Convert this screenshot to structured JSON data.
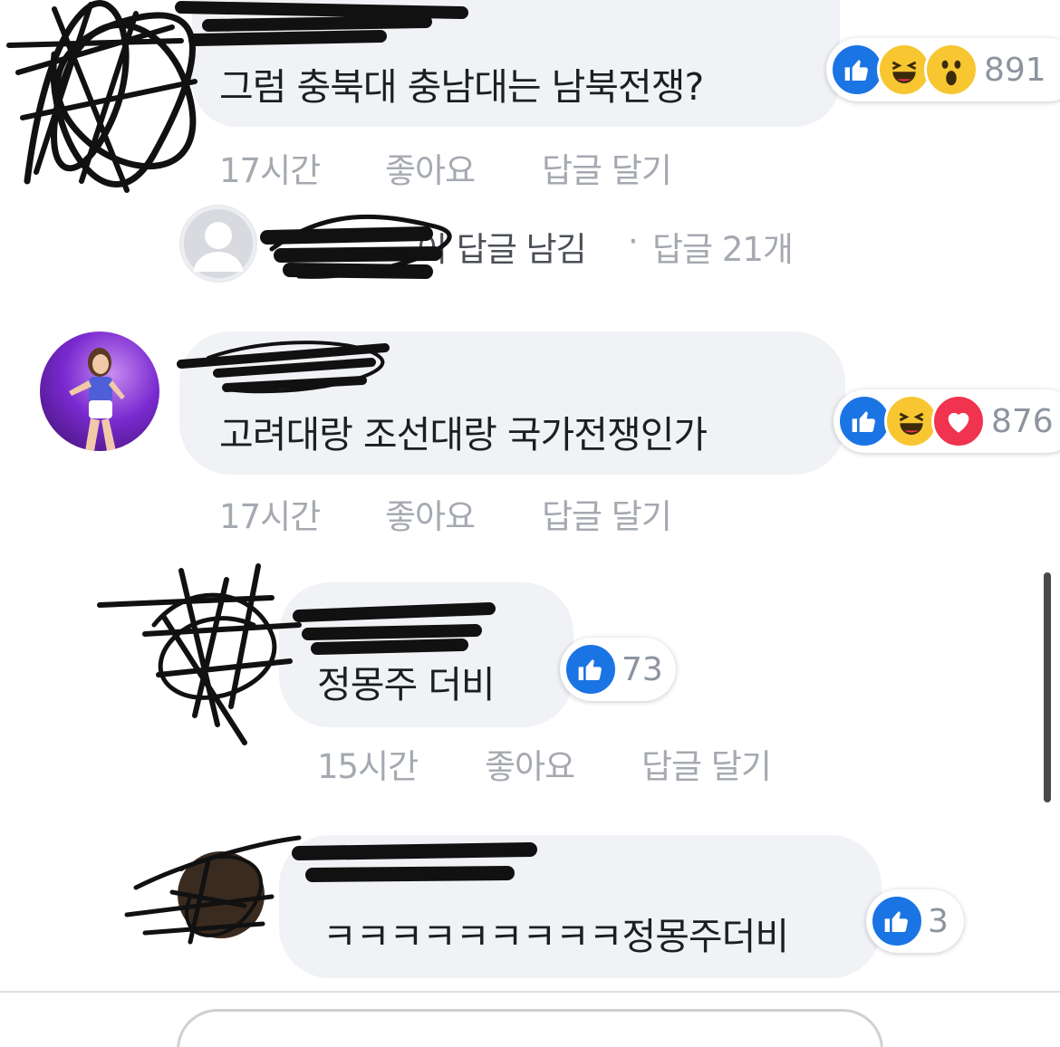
{
  "comments": [
    {
      "text": "그럼 충북대 충남대는 남북전쟁?",
      "reactions": [
        "like-icon",
        "haha-icon",
        "wow-icon"
      ],
      "reaction_count": "891",
      "time": "17시간",
      "like_label": "좋아요",
      "reply_label": "답글 달기",
      "replies_summary": {
        "author_suffix": "이 답글 남김",
        "dot": "·",
        "count_label": "답글 21개"
      }
    },
    {
      "text": "고려대랑 조선대랑 국가전쟁인가",
      "reactions": [
        "like-icon",
        "haha-icon",
        "love-icon"
      ],
      "reaction_count": "876",
      "time": "17시간",
      "like_label": "좋아요",
      "reply_label": "답글 달기"
    },
    {
      "text": "정몽주 더비",
      "reactions": [
        "like-icon"
      ],
      "reaction_count": "73",
      "time": "15시간",
      "like_label": "좋아요",
      "reply_label": "답글 달기"
    },
    {
      "text": "ㅋㅋㅋㅋㅋㅋㅋㅋㅋ정몽주더비",
      "reactions": [
        "like-icon"
      ],
      "reaction_count": "3"
    }
  ],
  "colors": {
    "like": "#1b74e4",
    "haha": "#f7c631",
    "love": "#f0334e",
    "bubble": "#f0f2f5",
    "meta_text": "#a5a9b0"
  }
}
